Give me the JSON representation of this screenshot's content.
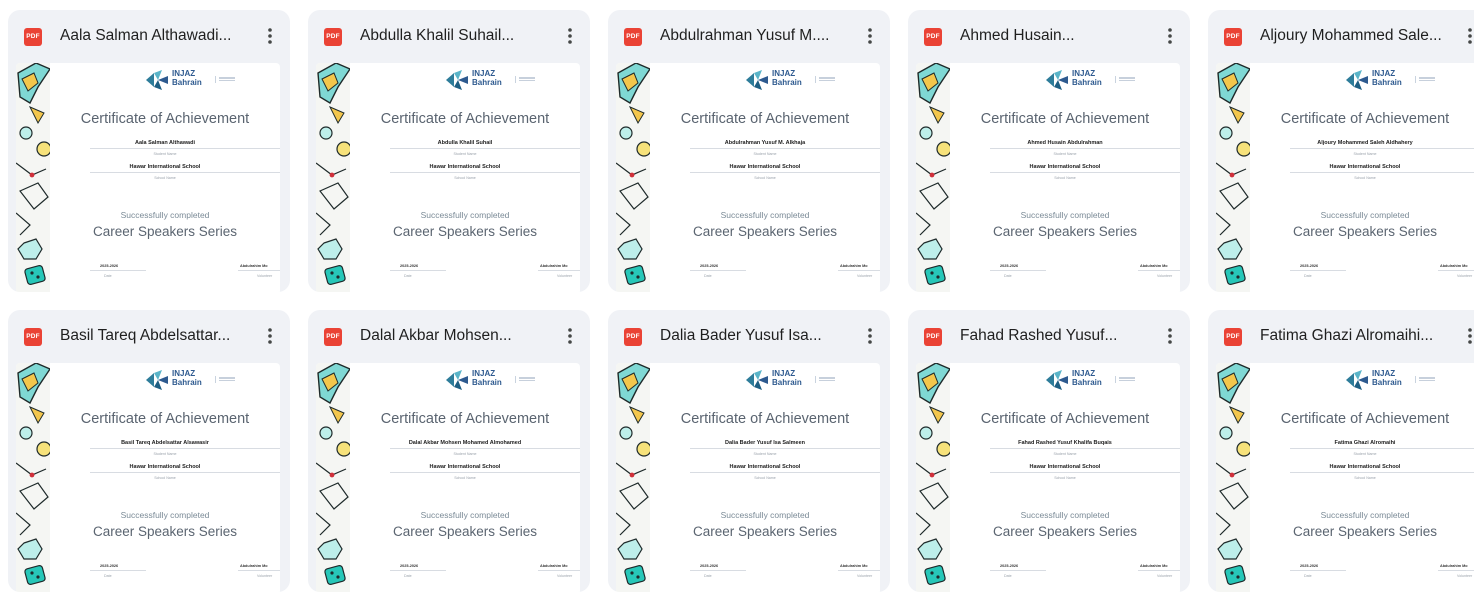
{
  "file_type_label": "PDF",
  "colors": {
    "pdf_badge": "#ea4335",
    "card_bg": "#f0f2f6",
    "logo_blue": "#2e5a8f",
    "title_gray": "#5a6470"
  },
  "icons": {
    "file": "pdf-icon",
    "menu": "more-vert-icon"
  },
  "certificate": {
    "logo_line1": "INJAZ",
    "logo_line2": "Bahrain",
    "title": "Certificate of Achievement",
    "name_caption": "Student Name",
    "school_caption": "School Name",
    "completed_text": "Successfully completed",
    "program": "Career Speakers Series",
    "year": "2025-2026",
    "date_caption": "Date",
    "signer": "Abdulrahim Mo",
    "volunteer_caption": "Volunteer"
  },
  "files": [
    {
      "name": "Aala Salman Althawadi...",
      "student": "Aala Salman Althawadi",
      "school": "Hawar International School"
    },
    {
      "name": "Abdulla Khalil Suhail...",
      "student": "Abdulla Khalil Suhail",
      "school": "Hawar International School"
    },
    {
      "name": "Abdulrahman Yusuf M....",
      "student": "Abdulrahman Yusuf M. Alkhaja",
      "school": "Hawar International School"
    },
    {
      "name": "Ahmed Husain...",
      "student": "Ahmed Husain Abdulrahman",
      "school": "Hawar International School"
    },
    {
      "name": "Aljoury Mohammed Sale...",
      "student": "Aljoury Mohammed Saleh Aldhahery",
      "school": "Hawar International School"
    },
    {
      "name": "Basil Tareq Abdelsattar...",
      "student": "Basil Tareq Abdelsattar Alsawasir",
      "school": "Hawar International School"
    },
    {
      "name": "Dalal Akbar Mohsen...",
      "student": "Dalal Akbar Mohsen Mohamed Almohamed",
      "school": "Hawar International School"
    },
    {
      "name": "Dalia Bader Yusuf Isa...",
      "student": "Dalia Bader Yusuf Isa Salmeen",
      "school": "Hawar International School"
    },
    {
      "name": "Fahad Rashed Yusuf...",
      "student": "Fahad Rashed Yusuf Khalifa Buqais",
      "school": "Hawar International School"
    },
    {
      "name": "Fatima Ghazi Alromaihi...",
      "student": "Fatima Ghazi Alromaihi",
      "school": "Hawar International School"
    }
  ]
}
